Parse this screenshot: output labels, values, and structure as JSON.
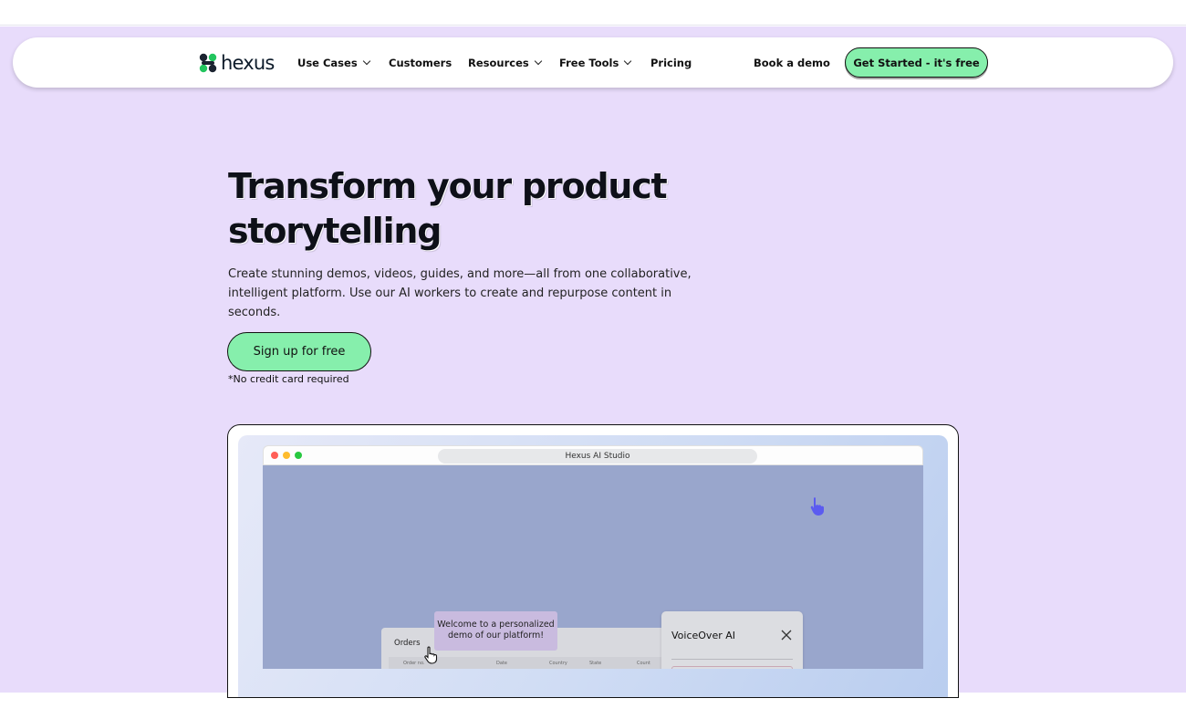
{
  "brand": {
    "name": "hexus"
  },
  "nav": {
    "items": [
      {
        "label": "Use Cases",
        "has_dropdown": true
      },
      {
        "label": "Customers",
        "has_dropdown": false
      },
      {
        "label": "Resources",
        "has_dropdown": true
      },
      {
        "label": "Free Tools",
        "has_dropdown": true
      },
      {
        "label": "Pricing",
        "has_dropdown": false
      }
    ],
    "book_demo": "Book a demo",
    "cta": "Get Started - it's free"
  },
  "hero": {
    "title": "Transform your product storytelling",
    "subtitle": "Create stunning demos, videos, guides, and more—all from one collaborative, intelligent platform. Use our AI workers to create and repurpose content in seconds.",
    "signup_button": "Sign up for free",
    "note": "*No credit card required"
  },
  "demo": {
    "url_title": "Hexus AI Studio",
    "orders_title": "Orders",
    "columns": [
      "Order no.",
      "Date",
      "Country",
      "State",
      "Count"
    ],
    "tooltip": "Welcome to a personalized demo of our platform!",
    "voiceover_title": "VoiceOver AI"
  },
  "colors": {
    "hero_bg": "#e8dcfb",
    "cta_green": "#86efac",
    "preview_bg": "#99a6cc",
    "pointer_purple": "#5b5bf0"
  }
}
